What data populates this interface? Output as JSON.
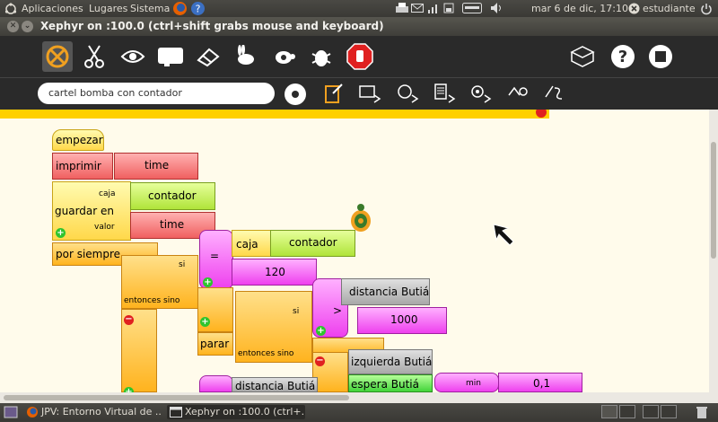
{
  "topbar": {
    "apps": "Aplicaciones",
    "places": "Lugares",
    "system": "Sistema",
    "datetime": "mar  6 de dic, 17:10",
    "user": "estudiante"
  },
  "window": {
    "title": "Xephyr on :100.0 (ctrl+shift grabs mouse and keyboard)"
  },
  "toolbar": {
    "search_value": "cartel bomba con contador"
  },
  "blocks": {
    "empezar": "empezar",
    "imprimir": "imprimir",
    "time1": "time",
    "caja1": "caja",
    "guardar": "guardar en",
    "valor": "valor",
    "contador1": "contador",
    "time2": "time",
    "por_siempre": "por siempre",
    "si1": "si",
    "entonces_sino1": "entonces sino",
    "eq": "=",
    "caja2": "caja",
    "contador2": "contador",
    "v120": "120",
    "parar": "parar",
    "si2": "si",
    "entonces_sino2": "entonces sino",
    "distancia1": "distancia Butiá",
    "gt": ">",
    "v1000": "1000",
    "izquierda": "izquierda Butiá",
    "espera": "espera Butiá",
    "min": "min",
    "v01": "0,1",
    "distancia2": "distancia Butiá"
  },
  "taskbar": {
    "task1": "JPV: Entorno Virtual de ...",
    "task2": "Xephyr on :100.0 (ctrl+..."
  }
}
